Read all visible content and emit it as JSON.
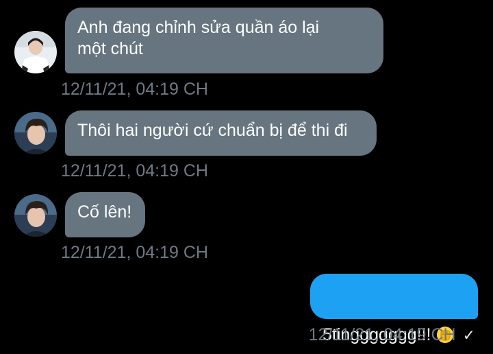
{
  "conversation": {
    "messages": [
      {
        "direction": "incoming",
        "text": "Anh đang chỉnh sửa quần áo lại\nmột chút",
        "timestamp": "12/11/21, 04:19 CH",
        "avatar": "user-avatar-1"
      },
      {
        "direction": "incoming",
        "text": "Thôi hai người cứ chuẩn bị để thi đi",
        "timestamp": "12/11/21, 04:19 CH",
        "avatar": "user-avatar-2"
      },
      {
        "direction": "incoming",
        "text": "Cố lên!",
        "timestamp": "12/11/21, 04:19 CH",
        "avatar": "user-avatar-2"
      },
      {
        "direction": "outgoing",
        "text": "5tinggggggg!!!",
        "emoji": "✊",
        "timestamp": "12/11/21, 04:19 CH",
        "status": "✓"
      }
    ]
  },
  "colors": {
    "background": "#000000",
    "incoming_bubble": "#66757f",
    "outgoing_bubble": "#1da1f2",
    "timestamp": "#6e7a85"
  }
}
